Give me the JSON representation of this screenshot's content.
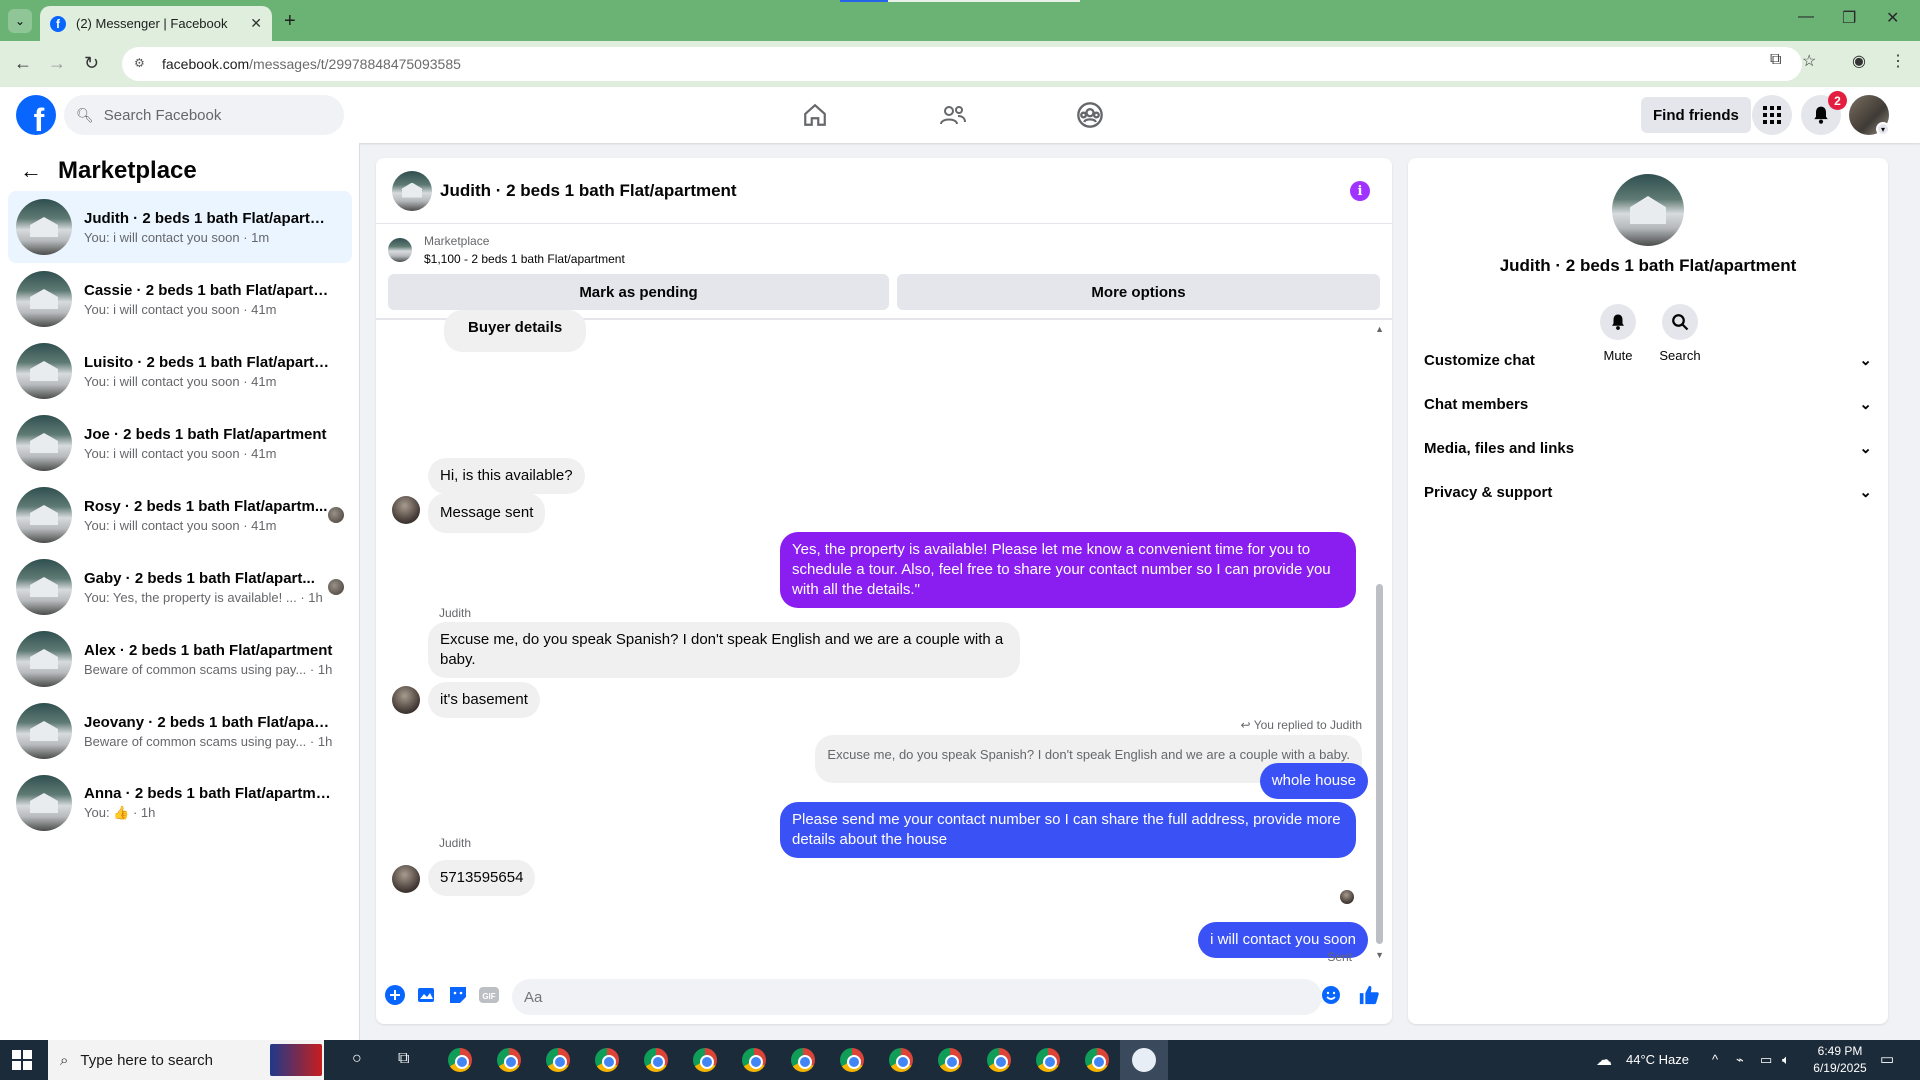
{
  "browser": {
    "tab_title": "(2) Messenger | Facebook",
    "url_host": "facebook.com",
    "url_path": "/messages/t/29978848475093585"
  },
  "fb_header": {
    "search_placeholder": "Search Facebook",
    "find_friends": "Find friends",
    "notif_count": "2"
  },
  "sidebar": {
    "title": "Marketplace",
    "conversations": [
      {
        "name": "Judith · 2 beds 1 bath Flat/apartm...",
        "last": "You: i will contact you soon · 1m"
      },
      {
        "name": "Cassie · 2 beds 1 bath Flat/apartm...",
        "last": "You: i will contact you soon · 41m"
      },
      {
        "name": "Luisito · 2 beds 1 bath Flat/apartm...",
        "last": "You: i will contact you soon · 41m"
      },
      {
        "name": "Joe · 2 beds 1 bath Flat/apartment",
        "last": "You: i will contact you soon · 41m"
      },
      {
        "name": "Rosy · 2 beds 1 bath Flat/apartm...",
        "last": "You: i will contact you soon · 41m"
      },
      {
        "name": "Gaby · 2 beds 1 bath Flat/apart...",
        "last": "You: Yes, the property is available! ...  · 1h"
      },
      {
        "name": "Alex · 2 beds 1 bath Flat/apartment",
        "last": "Beware of common scams using pay... · 1h"
      },
      {
        "name": "Jeovany · 2 beds 1 bath Flat/apart...",
        "last": "Beware of common scams using pay... · 1h"
      },
      {
        "name": "Anna · 2 beds 1 bath Flat/apartment",
        "last": "You: 👍 · 1h"
      }
    ]
  },
  "chat": {
    "header_name": "Judith · 2 beds 1 bath Flat/apartment",
    "listing_category": "Marketplace",
    "listing_title": "$1,100 - 2 beds 1 bath Flat/apartment",
    "mark_pending": "Mark as pending",
    "more_options": "More options",
    "messages": {
      "buyer_details": "Buyer details",
      "m1": "Hi, is this available?",
      "m2": "Message sent",
      "m3": "Yes, the property is available! Please let me know a convenient time for you to schedule a tour. Also, feel free to share your contact number so I can provide you with all the details.\"",
      "sender1": "Judith",
      "m4": "Excuse me, do you speak Spanish? I don't speak English and we are a couple with a baby.",
      "m5": "it's basement",
      "reply_note": "You replied to Judith",
      "quoted": "Excuse me, do you speak Spanish? I don't speak English and we are a couple with a baby.",
      "m6": "whole house",
      "m7": "Please send me your contact number so I can share the full address, provide more details about the house",
      "sender2": "Judith",
      "m8": "5713595654",
      "m9": "i will contact you soon",
      "status": "Sent"
    },
    "composer_placeholder": "Aa"
  },
  "info_panel": {
    "name": "Judith · 2 beds 1 bath Flat/apartment",
    "mute": "Mute",
    "search": "Search",
    "rows": [
      "Customize chat",
      "Chat members",
      "Media, files and links",
      "Privacy & support"
    ]
  },
  "taskbar": {
    "search_placeholder": "Type here to search",
    "weather": "44°C  Haze",
    "time": "6:49 PM",
    "date": "6/19/2025"
  },
  "colors": {
    "fb_blue": "#0866ff",
    "out_bubble_purple": "#8a1ef0",
    "out_bubble_blue": "#3a52f5",
    "browser_green": "#6bb374"
  }
}
